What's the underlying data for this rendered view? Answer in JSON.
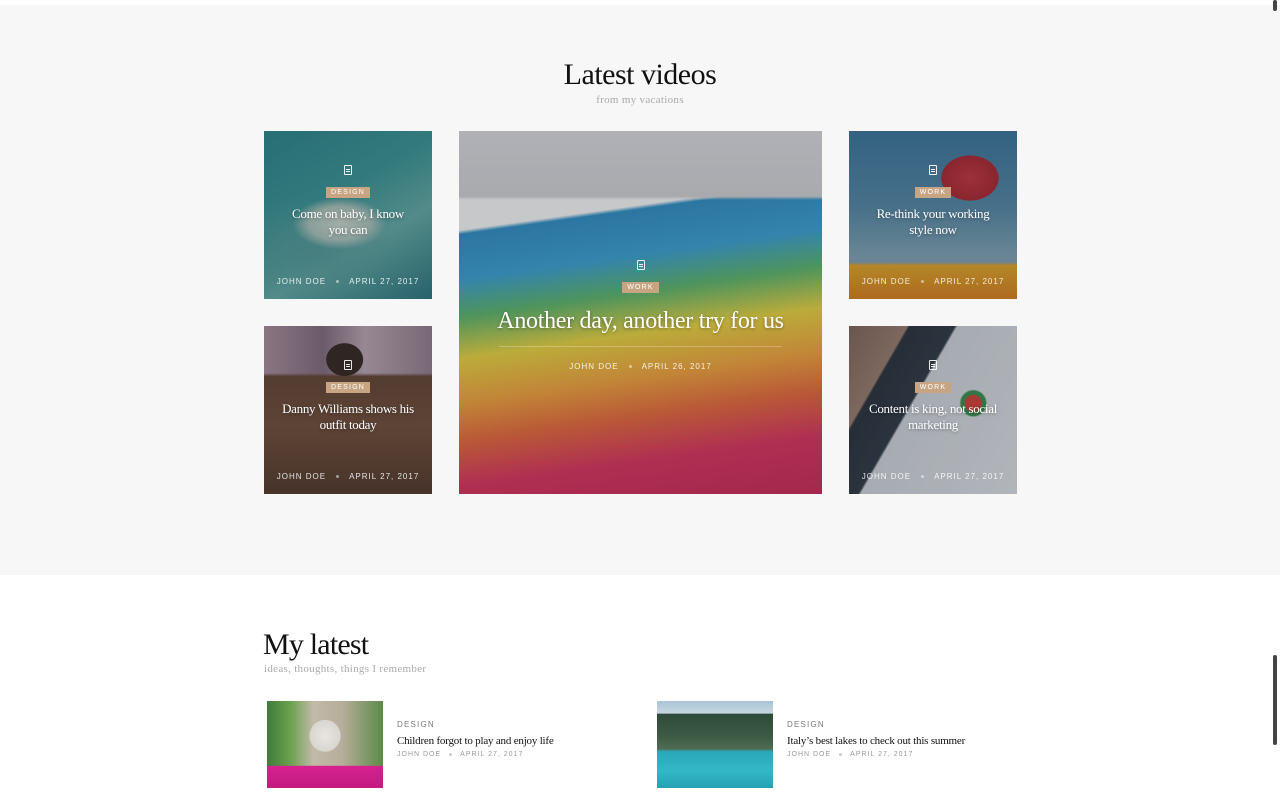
{
  "videos": {
    "title": "Latest videos",
    "subtitle": "from my vacations",
    "cards": [
      {
        "category": "DESIGN",
        "title": "Come on baby, I know you can",
        "author": "JOHN DOE",
        "date": "APRIL 27, 2017",
        "icon": "document-icon"
      },
      {
        "category": "DESIGN",
        "title": "Danny Williams shows his outfit today",
        "author": "JOHN DOE",
        "date": "APRIL 27, 2017",
        "icon": "document-icon"
      },
      {
        "category": "WORK",
        "title": "Another day, another try for us",
        "author": "JOHN DOE",
        "date": "APRIL 26, 2017",
        "icon": "document-icon"
      },
      {
        "category": "WORK",
        "title": "Re-think your working style now",
        "author": "JOHN DOE",
        "date": "APRIL 27, 2017",
        "icon": "document-icon"
      },
      {
        "category": "WORK",
        "title": "Content is king, not social marketing",
        "author": "JOHN DOE",
        "date": "APRIL 27, 2017",
        "icon": "document-icon"
      }
    ]
  },
  "latest": {
    "title": "My latest",
    "subtitle": "ideas, thoughts, things I remember",
    "posts": [
      {
        "category": "DESIGN",
        "title": "Children forgot to play and enjoy life",
        "author": "JOHN DOE",
        "date": "APRIL 27, 2017"
      },
      {
        "category": "DESIGN",
        "title": "Italy’s best lakes to check out this summer",
        "author": "JOHN DOE",
        "date": "APRIL 27, 2017"
      }
    ]
  },
  "colors": {
    "accent_badge": "#c7a582",
    "section_bg": "#f7f7f7",
    "text": "#111111",
    "muted": "#aaaaaa"
  }
}
